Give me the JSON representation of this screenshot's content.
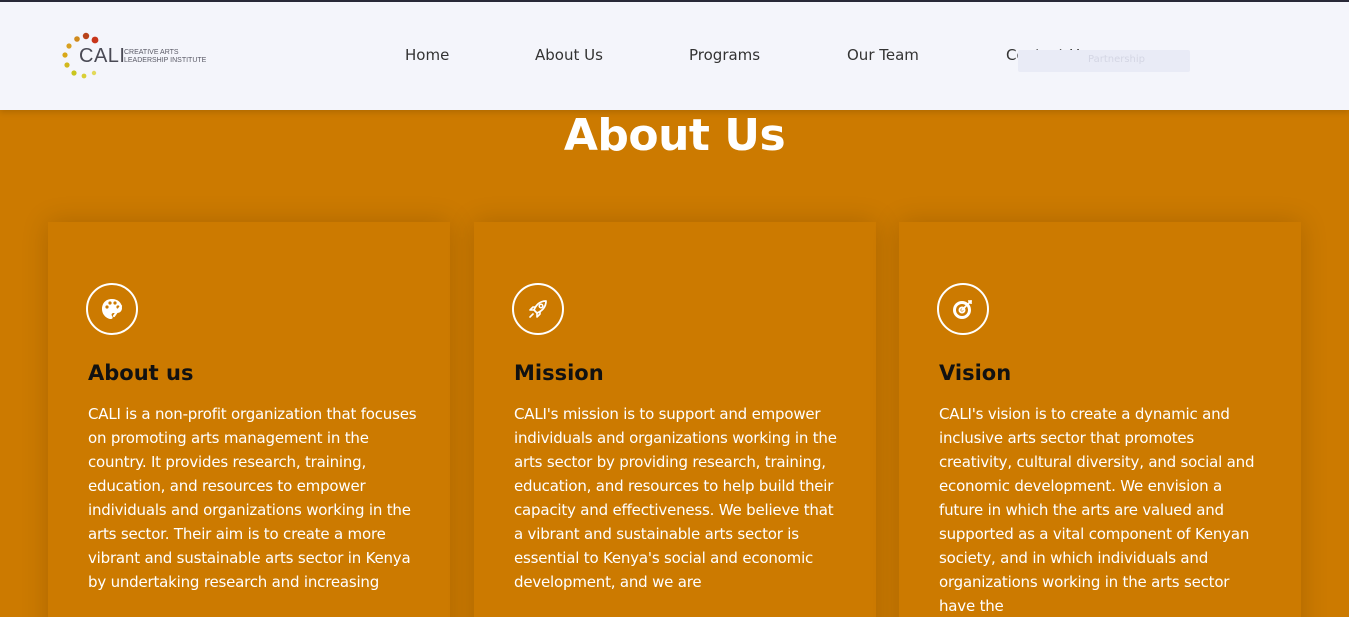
{
  "header": {
    "logo_word": "CALI",
    "logo_subtitle": "Creative Arts Leadership Institute",
    "nav": [
      {
        "label": "Home"
      },
      {
        "label": "About Us"
      },
      {
        "label": "Programs"
      },
      {
        "label": "Our Team"
      },
      {
        "label": "Contact Us"
      }
    ],
    "ghost_button_label": "Partnership"
  },
  "page": {
    "title": "About Us"
  },
  "cards": [
    {
      "icon": "palette-icon",
      "heading": "About us",
      "body": "CALI is a non-profit organization that focuses on promoting arts management in the country. It provides research, training, education, and resources to empower individuals and organizations working in the arts sector. Their aim is to create a more vibrant and sustainable arts sector in Kenya by undertaking research and increasing"
    },
    {
      "icon": "rocket-icon",
      "heading": "Mission",
      "body": "CALI's mission is to support and empower individuals and organizations working in the arts sector by providing research, training, education, and resources to help build their capacity and effectiveness. We believe that a vibrant and sustainable arts sector is essential to Kenya's social and economic development, and we are"
    },
    {
      "icon": "target-icon",
      "heading": "Vision",
      "body": "CALI's vision is to create a dynamic and inclusive arts sector that promotes creativity, cultural diversity, and social and economic development. We envision a future in which the arts are valued and supported as a vital component of Kenyan society, and in which individuals and organizations working in the arts sector have the"
    }
  ],
  "colors": {
    "accent": "#cc7a00",
    "header_bg": "#f4f5fb",
    "card_text": "#ffffff",
    "heading_text": "#111111"
  }
}
